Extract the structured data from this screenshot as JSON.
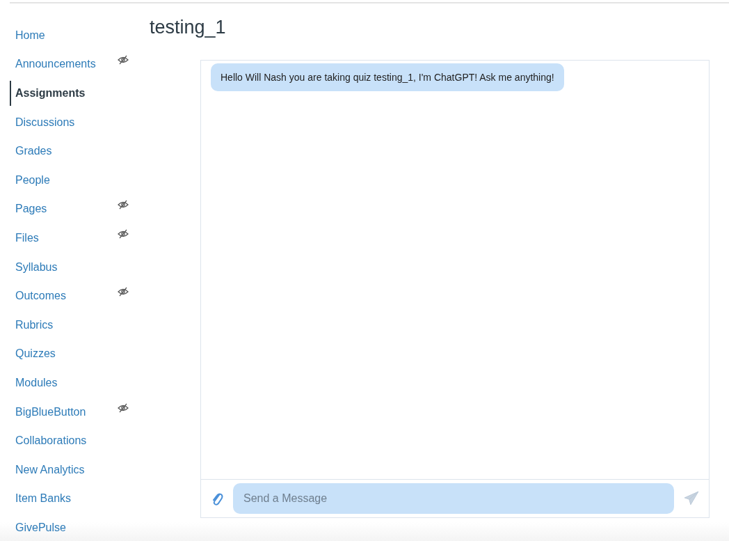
{
  "page": {
    "title": "testing_1"
  },
  "sidebar": {
    "items": [
      {
        "label": "Home",
        "selected": false,
        "hidden": false
      },
      {
        "label": "Announcements",
        "selected": false,
        "hidden": true
      },
      {
        "label": "Assignments",
        "selected": true,
        "hidden": false
      },
      {
        "label": "Discussions",
        "selected": false,
        "hidden": false
      },
      {
        "label": "Grades",
        "selected": false,
        "hidden": false
      },
      {
        "label": "People",
        "selected": false,
        "hidden": false
      },
      {
        "label": "Pages",
        "selected": false,
        "hidden": true
      },
      {
        "label": "Files",
        "selected": false,
        "hidden": true
      },
      {
        "label": "Syllabus",
        "selected": false,
        "hidden": false
      },
      {
        "label": "Outcomes",
        "selected": false,
        "hidden": true
      },
      {
        "label": "Rubrics",
        "selected": false,
        "hidden": false
      },
      {
        "label": "Quizzes",
        "selected": false,
        "hidden": false
      },
      {
        "label": "Modules",
        "selected": false,
        "hidden": false
      },
      {
        "label": "BigBlueButton",
        "selected": false,
        "hidden": true
      },
      {
        "label": "Collaborations",
        "selected": false,
        "hidden": false
      },
      {
        "label": "New Analytics",
        "selected": false,
        "hidden": false
      },
      {
        "label": "Item Banks",
        "selected": false,
        "hidden": false
      },
      {
        "label": "GivePulse",
        "selected": false,
        "hidden": false
      }
    ]
  },
  "chat": {
    "messages": [
      {
        "text": "Hello Will Nash you are taking quiz testing_1, I'm ChatGPT! Ask me anything!"
      }
    ],
    "input": {
      "placeholder": "Send a Message"
    }
  }
}
